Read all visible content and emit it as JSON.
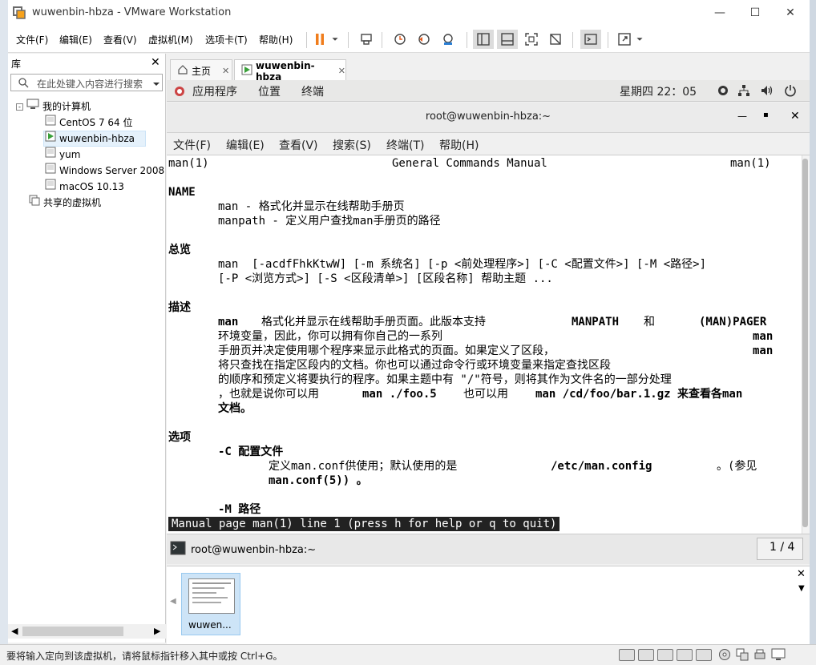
{
  "window": {
    "title": "wuwenbin-hbza - VMware Workstation",
    "minimize": "—",
    "maximize": "☐",
    "close": "✕"
  },
  "menu": [
    "文件(F)",
    "编辑(E)",
    "查看(V)",
    "虚拟机(M)",
    "选项卡(T)",
    "帮助(H)"
  ],
  "library": {
    "title": "库",
    "close": "✕",
    "search_placeholder": "在此处键入内容进行搜索",
    "tree": {
      "root": "我的计算机",
      "vms": [
        "CentOS 7 64 位",
        "wuwenbin-hbza",
        "yum",
        "Windows Server 2008",
        "macOS 10.13"
      ],
      "selected": "wuwenbin-hbza",
      "shared": "共享的虚拟机"
    }
  },
  "tabs": [
    {
      "label": "主页",
      "close": "✕"
    },
    {
      "label": "wuwenbin-hbza",
      "close": "✕"
    }
  ],
  "gnome": {
    "menus": [
      "应用程序",
      "位置",
      "终端"
    ],
    "clock": "星期四 22：05"
  },
  "terminal": {
    "title": "root@wuwenbin-hbza:~",
    "win_min": "—",
    "win_max": "▪",
    "win_close": "✕",
    "menu": [
      "文件(F)",
      "编辑(E)",
      "查看(V)",
      "搜索(S)",
      "终端(T)",
      "帮助(H)"
    ],
    "header_left": "man(1)",
    "header_center": "General Commands Manual",
    "header_right": "man(1)",
    "sec_name": "NAME",
    "name_line1": "man - 格式化并显示在线帮助手册页",
    "name_line2": "manpath - 定义用户查找man手册页的路径",
    "sec_synopsis": "总览",
    "syn_line1": "man  [-acdfFhkKtwW] [-m 系统名] [-p <前处理程序>] [-C <配置文件>] [-M <路径>]",
    "syn_line2": "[-P <浏览方式>] [-S <区段清单>] [区段名称] 帮助主题 ...",
    "sec_desc": "描述",
    "desc_1a": "man",
    "desc_1b": "格式化并显示在线帮助手册页面。此版本支持",
    "desc_1c": "MANPATH",
    "desc_1d": "和",
    "desc_1e": "(MAN)PAGER",
    "desc_2a": "环境变量，因此，你可以拥有你自己的一系列",
    "desc_2b": "man",
    "desc_3a": "手册页并决定使用哪个程序来显示此格式的页面。如果定义了区段，",
    "desc_3b": "man",
    "desc_4": "将只查找在指定区段内的文档。你也可以通过命令行或环境变量来指定查找区段",
    "desc_5": "的顺序和预定义将要执行的程序。如果主题中有 \"/\"符号，则将其作为文件名的一部分处理",
    "desc_6a": "，也就是说你可以用",
    "desc_6b": "man ./foo.5",
    "desc_6c": "也可以用",
    "desc_6d": "man /cd/foo/bar.1.gz 来查看各man",
    "desc_7": "文档。",
    "sec_options": "选项",
    "opt_c": "-C 配置文件",
    "opt_c_desc_a": "定义man.conf供使用；默认使用的是",
    "opt_c_desc_b": "/etc/man.config",
    "opt_c_desc_c": "。(参见",
    "opt_c_desc_d": "man.conf(5)) 。",
    "opt_m": "-M 路径",
    "status": "Manual page man(1) line 1 (press h for help or q to quit)"
  },
  "vm_taskbar": {
    "item": "root@wuwenbin-hbza:~",
    "page": "1 / 4"
  },
  "thumbnail": {
    "label": "wuwen..."
  },
  "statusbar": {
    "text": "要将输入定向到该虚拟机，请将鼠标指针移入其中或按 Ctrl+G。"
  }
}
